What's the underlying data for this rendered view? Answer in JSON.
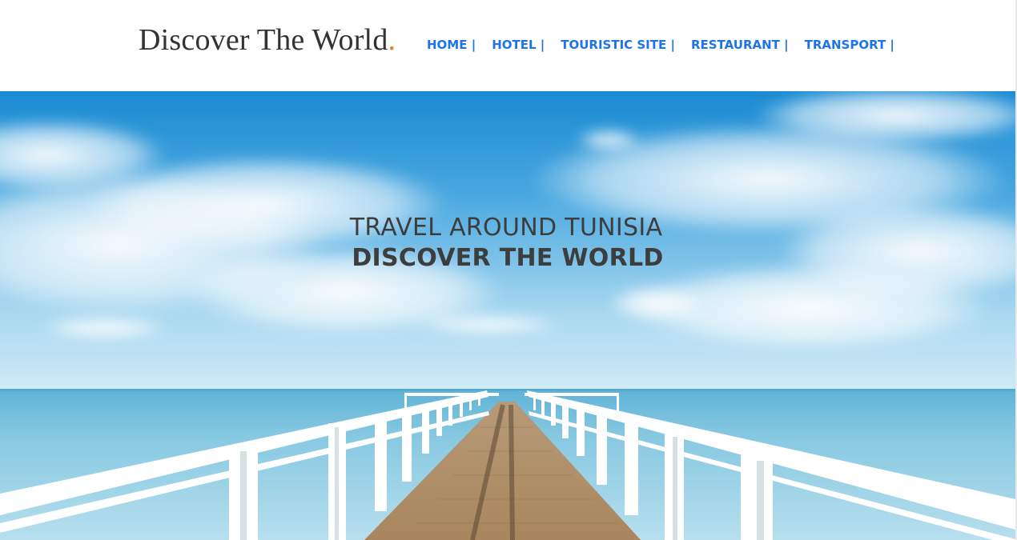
{
  "header": {
    "logo_text": "Discover The World",
    "logo_dot": ".",
    "nav": [
      {
        "label": "HOME |"
      },
      {
        "label": "HOTEL |"
      },
      {
        "label": "TOURISTIC SITE |"
      },
      {
        "label": "RESTAURANT |"
      },
      {
        "label": "TRANSPORT |"
      }
    ]
  },
  "hero": {
    "line1": "TRAVEL AROUND TUNISIA",
    "line2": "DISCOVER THE WORLD",
    "image_subject": "wooden pier with white railings over calm sea under blue cloudy sky"
  },
  "colors": {
    "nav_link": "#1e73e8",
    "logo_dot": "#e67e22",
    "logo_text": "#333333",
    "hero_text": "#3d3d3d",
    "sky_top": "#1d8fd6",
    "sea": "#79c3dd"
  }
}
